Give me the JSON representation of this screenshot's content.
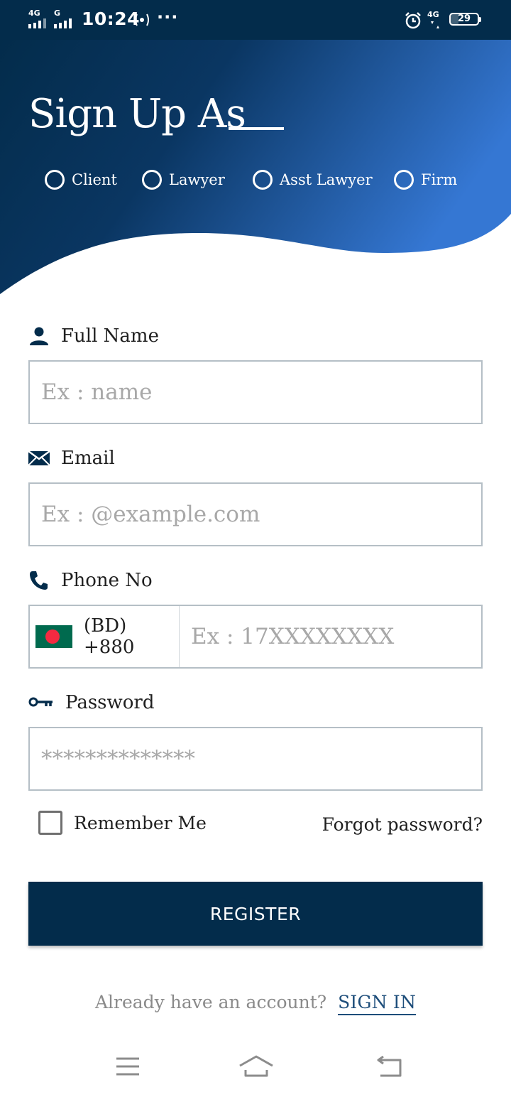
{
  "status_bar": {
    "time": "10:24",
    "net_left_1": "4G",
    "net_left_2": "G",
    "net_right": "4G",
    "battery": "29",
    "battery_level": 0.29
  },
  "header": {
    "title": "Sign Up As",
    "roles": [
      "Client",
      "Lawyer",
      "Asst Lawyer",
      "Firm"
    ]
  },
  "form": {
    "full_name": {
      "label": "Full Name",
      "placeholder": "Ex : name",
      "value": ""
    },
    "email": {
      "label": "Email",
      "placeholder": "Ex : @example.com",
      "value": ""
    },
    "phone": {
      "label": "Phone No",
      "country_code": "(BD) +880",
      "placeholder": "Ex : 17XXXXXXXX",
      "value": ""
    },
    "password": {
      "label": "Password",
      "placeholder": "**************",
      "value": ""
    },
    "remember_label": "Remember Me",
    "remember_checked": false,
    "forgot_label": "Forgot password?",
    "register_label": "REGISTER"
  },
  "footer": {
    "prompt": "Already have an account?",
    "signin_label": "SIGN IN"
  },
  "colors": {
    "primary": "#032c4b",
    "gradient_end": "#3577d3",
    "input_border": "#b5bfc6"
  }
}
